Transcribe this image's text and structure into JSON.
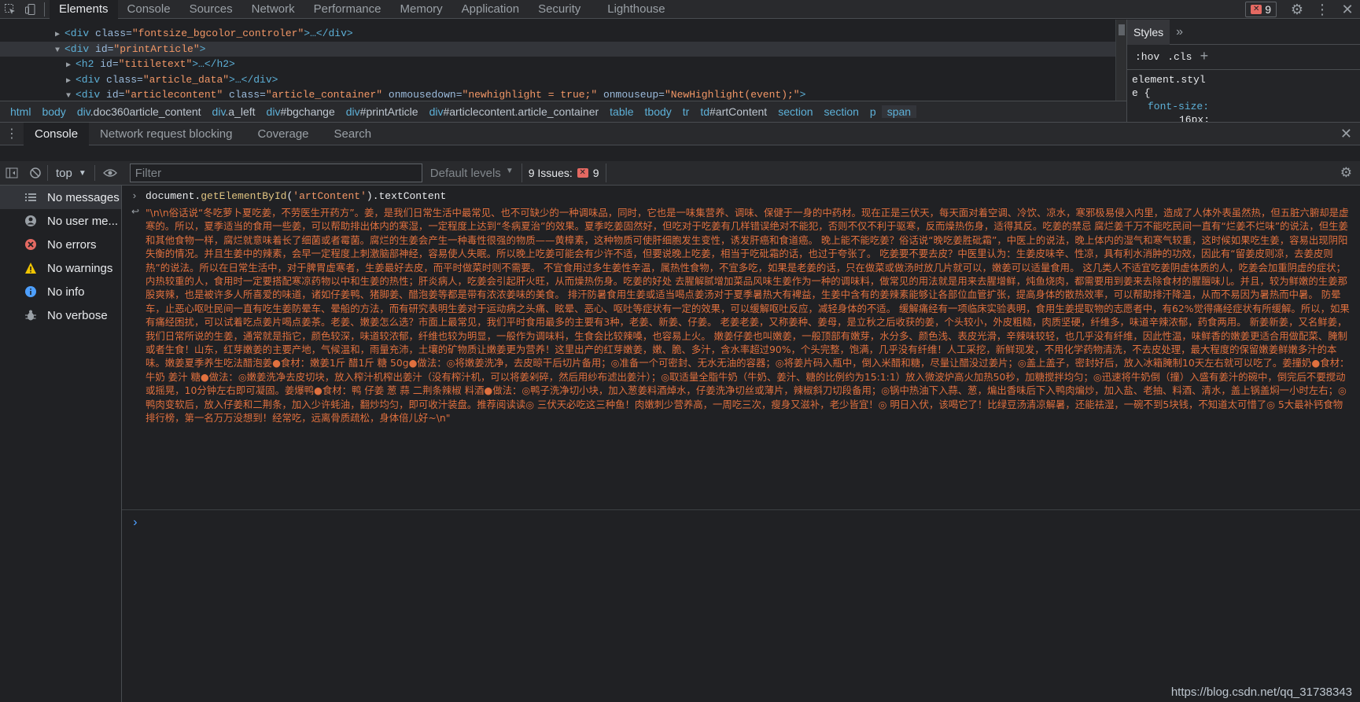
{
  "top_tabs": [
    "Elements",
    "Console",
    "Sources",
    "Network",
    "Performance",
    "Memory",
    "Application",
    "Security",
    "Lighthouse"
  ],
  "issues_count": "9",
  "dom_tree": [
    {
      "pre": "<div ",
      "attr": "class=",
      "val": "\"fontsize_bgcolor_controler\"",
      "post": ">…</div>"
    },
    {
      "pre": "<div ",
      "attr": "id=",
      "val": "\"printArticle\"",
      "post": ">"
    },
    {
      "pre": "<h2 ",
      "attr": "id=",
      "val": "\"titiletext\"",
      "post": ">…</h2>"
    },
    {
      "pre": "<div ",
      "attr": "class=",
      "val": "\"article_data\"",
      "post": ">…</div>"
    },
    {
      "pre": "<div ",
      "attr": "id=",
      "val": "\"articlecontent\"",
      "attr2": " class=",
      "val2": "\"article_container\"",
      "attr3": " onmousedown=",
      "val3": "\"newhighlight = true;\"",
      "attr4": " onmouseup=",
      "val4": "\"NewHighlight(event);\"",
      "post": ">"
    }
  ],
  "styles_panel": {
    "tab": "Styles",
    "hov": ":hov",
    "cls": ".cls",
    "selector_1": "element.styl",
    "selector_2": "e {",
    "prop": "font-size:",
    "value": "16px;"
  },
  "breadcrumb": [
    {
      "tag": "html",
      "rest": ""
    },
    {
      "tag": "body",
      "rest": ""
    },
    {
      "tag": "div",
      "rest": ".doc360article_content"
    },
    {
      "tag": "div",
      "rest": ".a_left"
    },
    {
      "tag": "div",
      "rest": "#bgchange"
    },
    {
      "tag": "div",
      "rest": "#printArticle"
    },
    {
      "tag": "div",
      "rest": "#articlecontent.article_container"
    },
    {
      "tag": "table",
      "rest": ""
    },
    {
      "tag": "tbody",
      "rest": ""
    },
    {
      "tag": "tr",
      "rest": ""
    },
    {
      "tag": "td",
      "rest": "#artContent"
    },
    {
      "tag": "section",
      "rest": ""
    },
    {
      "tag": "section",
      "rest": ""
    },
    {
      "tag": "p",
      "rest": ""
    },
    {
      "tag": "span",
      "rest": ""
    }
  ],
  "drawer_tabs": [
    "Console",
    "Network request blocking",
    "Coverage",
    "Search"
  ],
  "console_toolbar": {
    "context": "top",
    "filter_placeholder": "Filter",
    "levels": "Default levels",
    "issues_label": "9 Issues:",
    "issues_count": "9"
  },
  "sidebar": [
    {
      "label": "No messages",
      "icon": "list-icon",
      "color": "#9aa0a6"
    },
    {
      "label": "No user me...",
      "icon": "user-icon",
      "color": "#9aa0a6"
    },
    {
      "label": "No errors",
      "icon": "error-icon",
      "color": "#e46962"
    },
    {
      "label": "No warnings",
      "icon": "warning-icon",
      "color": "#f0c400"
    },
    {
      "label": "No info",
      "icon": "info-icon",
      "color": "#4d9fff"
    },
    {
      "label": "No verbose",
      "icon": "bug-icon",
      "color": "#9aa0a6"
    }
  ],
  "console": {
    "command_obj": "document",
    "command_method": "getElementById",
    "command_arg": "'artContent'",
    "command_prop": "textContent",
    "output": "\"\\n\\n俗话说“冬吃萝卜夏吃姜，不劳医生开药方”。姜，是我们日常生活中最常见、也不可缺少的一种调味品，同时，它也是一味集营养、调味、保健于一身的中药材。现在正是三伏天，每天面对着空调、冷饮、凉水，寒邪极易侵入内里，造成了人体外表虽然热，但五脏六腑却是虚寒的。所以，夏季适当的食用一些姜，可以帮助排出体内的寒湿，一定程度上达到“冬病夏治”的效果。夏季吃姜固然好，但吃对于吃姜有几样错误绝对不能犯，否则不仅不利于驱寒，反而燥热伤身，适得其反。吃姜的禁忌  腐烂姜千万不能吃民间一直有“烂姜不烂味”的说法，但生姜和其他食物一样，腐烂就意味着长了细菌或者霉菌。腐烂的生姜会产生一种毒性很强的物质——黄樟素，这种物质可使肝细胞发生变性，诱发肝癌和食道癌。  晚上能不能吃姜？俗话说“晚吃姜胜砒霜”，中医上的说法，晚上体内的湿气和寒气较重，这时候如果吃生姜，容易出现阴阳失衡的情况。并且生姜中的辣素，会早一定程度上刺激脑部神经，容易使人失眠。所以晚上吃姜可能会有少许不适，但要说晚上吃姜，相当于吃砒霜的话，也过于夸张了。  吃姜要不要去皮？中医里认为：生姜皮味辛、性凉，具有利水消肿的功效，因此有“留姜皮则凉，去姜皮则热”的说法。所以在日常生活中，对于脾胃虚寒者，生姜最好去皮，而平时做菜时则不需要。  不宜食用过多生姜性辛温，属热性食物，不宜多吃，如果是老姜的话，只在做菜或做汤时放几片就可以，嫩姜可以适量食用。  这几类人不适宜吃姜阴虚体质的人，吃姜会加重阴虚的症状；内热较重的人，食用时一定要搭配寒凉药物以中和生姜的热性；肝炎病人，吃姜会引起肝火旺，从而燥热伤身。吃姜的好处  去腥解腻增加菜品风味生姜作为一种的调味料，做常见的用法就是用来去腥增鲜，炖鱼烧肉，都需要用到姜来去除食材的腥膻味儿。并且，较为鲜嫩的生姜那股爽辣，也是被许多人所喜爱的味道，诸如仔姜鸭、猪脚姜、醋泡姜等都是带有浓浓姜味的美食。  排汗防暑食用生姜或适当喝点姜汤对于夏季暑热大有裨益，生姜中含有的姜辣素能够让各部位血管扩张，提高身体的散热效率，可以帮助排汗降温，从而不易因为暑热而中暑。  防晕车，止恶心呕吐民间一直有吃生姜防晕车、晕船的方法，而有研究表明生姜对于运动病之头痛、眩晕、恶心、呕吐等症状有一定的效果，可以缓解呕吐反应，减轻身体的不适。  缓解痛经有一项临床实验表明，食用生姜提取物的志愿者中，有62%觉得痛经症状有所缓解。所以，如果有痛经困扰，可以试着吃点姜片喝点姜茶。老姜、嫩姜怎么选？市面上最常见，我们平时食用最多的主要有3种，老姜、新姜、仔姜。  老姜老姜，又称姜种、姜母，是立秋之后收获的姜，个头较小，外皮粗糙，肉质坚硬，纤维多，味道辛辣浓郁，药食两用。  新姜新姜，又名鲜姜，我们日常所说的生姜，通常就是指它，颜色较深，味道较浓郁，纤维也较为明显，一般作为调味料，生食会比较辣嗓，也容易上火。  嫩姜仔姜也叫嫩姜，一般顶部有嫩芽，水分多、颜色浅、表皮光滑，辛辣味较轻，也几乎没有纤维，因此性温，味鲜香的嫩姜更适合用做配菜、腌制或者生食！山东，红芽嫩姜的主要产地，气候温和，雨量充沛，土壤的矿物质让嫩姜更为营养！这里出产的红芽嫩姜，嫩、脆、多汁，含水率超过90%，个头完整，饱满，几乎没有纤维！人工采挖，新鲜现发，不用化学药物清洗，不去皮处理，最大程度的保留嫩姜鲜嫩多汁的本味。嫩姜夏季养生吃法醋泡姜●食材：嫩姜1斤 醋1斤 糖 50g●做法：◎将嫩姜洗净，去皮晾干后切片备用；◎准备一个可密封、无水无油的容器；◎将姜片码入瓶中，倒入米醋和糖，尽量让醋没过姜片；◎盖上盖子，密封好后，放入冰箱腌制10天左右就可以吃了。姜撞奶●食材：牛奶 姜汁 糖●做法：◎嫩姜洗净去皮切块，放入榨汁机榨出姜汁（没有榨汁机，可以将姜剁碎，然后用纱布滤出姜汁）；◎取适量全脂牛奶（牛奶、姜汁、糖的比例约为15:1:1）放入微波炉高火加热50秒，加糖搅拌均匀；◎迅速将牛奶倒（撞）入盛有姜汁的碗中，倒完后不要搅动或摇晃，10分钟左右即可凝固。姜爆鸭●食材：鸭 仔姜 葱 蒜 二荆条辣椒 料酒●做法：◎鸭子洗净切小块，加入葱姜料酒焯水，仔姜洗净切丝或薄片，辣椒斜刀切段备用；◎锅中热油下入蒜、葱，煸出香味后下入鸭肉煸炒，加入盐、老抽、料酒、清水，盖上锅盖焖一小时左右；◎鸭肉变软后，放入仔姜和二荆条，加入少许蚝油，翻炒均匀，即可收汁装盘。推荐阅读读◎ 三伏天必吃这三种鱼！肉嫩刺少营养高，一周吃三次，瘦身又滋补，老少皆宜！◎ 明日入伏，该喝它了！比绿豆汤清凉解暑，还能祛湿，一碗不到5块钱，不知道太可惜了◎ 5大最补钙食物排行榜，第一名万万没想到！经常吃，远离骨质疏松，身体倍儿好~\\n\"",
    "prompt": "›"
  },
  "watermark": "https://blog.csdn.net/qq_31738343"
}
